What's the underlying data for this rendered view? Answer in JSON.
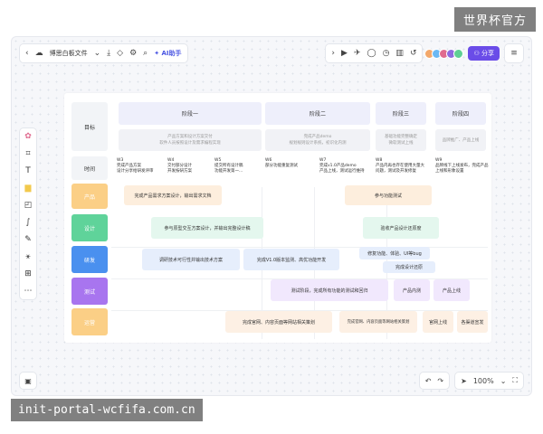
{
  "watermark": "世界杯官方",
  "caption": "init-portal-wcfifa.com.cn",
  "toolbar": {
    "back_icon": "chevron-left-icon",
    "doc_title": "博思白板文件",
    "doc_caret": "⌄",
    "ai_label": "AI助手",
    "share_label": "分享"
  },
  "bottom": {
    "zoom": "100%"
  },
  "board": {
    "goal_label": "目标",
    "time_label": "时间",
    "phases": [
      {
        "title": "阶段一",
        "desc": "产品方案和设计方案交付\n软件人员按照设计及需求编程实现"
      },
      {
        "title": "阶段二",
        "desc": "完成产品demo\n规划规则设计系统，初识化内测"
      },
      {
        "title": "阶段三",
        "desc": "基础功能完整确定\n微软测试上线"
      },
      {
        "title": "阶段四",
        "desc": "品牌推广、产品上线"
      }
    ],
    "weeks": [
      {
        "w": "W3",
        "t": "完成产品方案\n设计分享给研发评审"
      },
      {
        "w": "W4",
        "t": "交付部分设计\n开发按研方案"
      },
      {
        "w": "W5",
        "t": "提交所有设计稿\n功能开发第一..."
      },
      {
        "w": "W6",
        "t": "部分功能重复测试"
      },
      {
        "w": "W7",
        "t": "完成v1.0产品demo\n产品上线，测试运行维持"
      },
      {
        "w": "W8",
        "t": "产品内再也存在使用大量大\n问题，测试及开发修复"
      },
      {
        "w": "W9",
        "t": "品牌线下上线发布，完成产品\n上线和形象设置"
      }
    ],
    "rows": [
      {
        "label": "产品",
        "color": "#fbcf86"
      },
      {
        "label": "设计",
        "color": "#5fd39a"
      },
      {
        "label": "研发",
        "color": "#4a90ef"
      },
      {
        "label": "测试",
        "color": "#a875ef"
      },
      {
        "label": "运营",
        "color": "#fbcf86"
      }
    ],
    "tasks": {
      "p1": "完成产品需求方案设计，输出需求文档",
      "p2": "参与功能测试",
      "d1": "参与原型交互方案设计，并输出完整设计稿",
      "d2": "验收产品设计还原度",
      "r1": "调研技术可行性并输出技术方案",
      "r2": "完成V1.0版本监测、高优功能开发",
      "r3": "修复功能、体验、UI等bug",
      "r4": "完成设计还原",
      "q1": "测试阶段，完成所有功能的测试和回归",
      "q2": "产品内测",
      "q3": "产品上线",
      "o1": "完成官网、内容页面等网站相关策划",
      "o2": "完成官网、内容页面等网站相关策划",
      "o3": "官网上线",
      "o4": "各渠道宣发"
    }
  },
  "colors": {
    "accent": "#6a4ce8",
    "ai": "#4a56e2"
  }
}
